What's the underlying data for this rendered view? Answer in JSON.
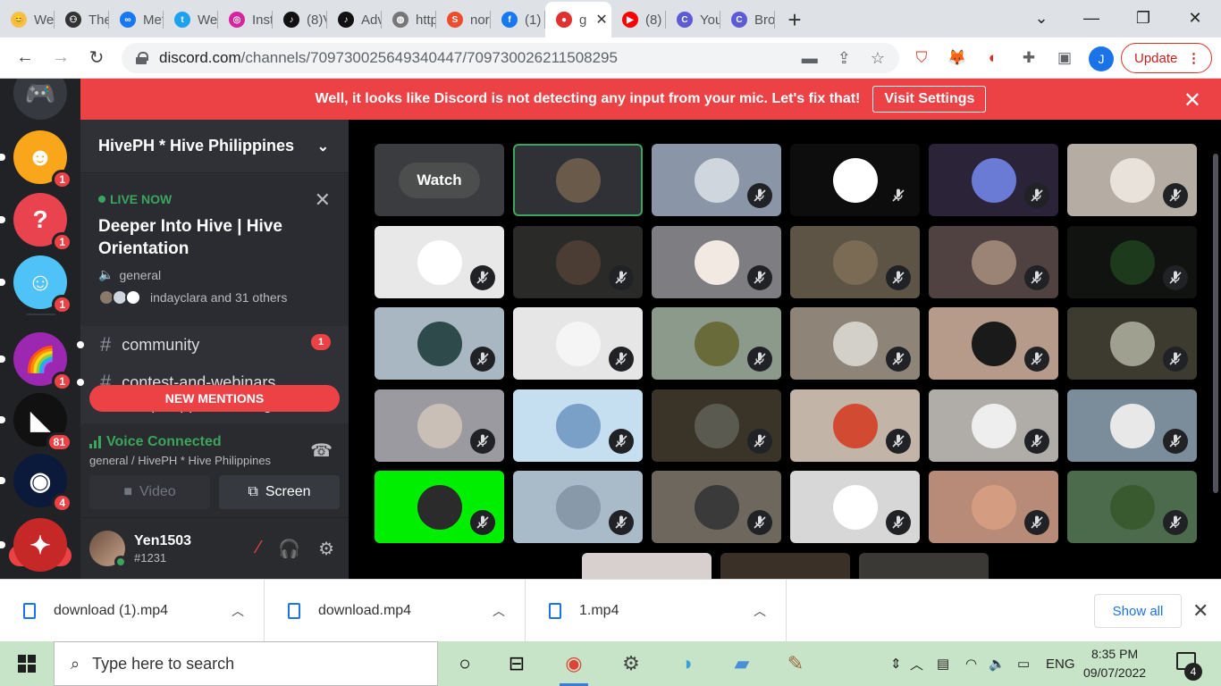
{
  "browser": {
    "tabs": [
      {
        "title": "We",
        "color": "#f6c04a",
        "glyph": "😊"
      },
      {
        "title": "The",
        "color": "#333333",
        "glyph": "⚇"
      },
      {
        "title": "Met",
        "color": "#1877f2",
        "glyph": "∞"
      },
      {
        "title": "We",
        "color": "#1da1f2",
        "glyph": "t"
      },
      {
        "title": "Inst",
        "color": "#d6249f",
        "glyph": "◎"
      },
      {
        "title": "(8)V",
        "color": "#111111",
        "glyph": "♪"
      },
      {
        "title": "Adv",
        "color": "#111111",
        "glyph": "♪"
      },
      {
        "title": "http",
        "color": "#777777",
        "glyph": "◍"
      },
      {
        "title": "nor",
        "color": "#ee4d2d",
        "glyph": "S"
      },
      {
        "title": "(1)",
        "color": "#1877f2",
        "glyph": "f"
      },
      {
        "title": "g",
        "color": "#e03030",
        "glyph": "●",
        "active": true
      },
      {
        "title": "(8)",
        "color": "#ff0000",
        "glyph": "▶"
      },
      {
        "title": "You",
        "color": "#5b5bd6",
        "glyph": "C"
      },
      {
        "title": "Bro",
        "color": "#5b5bd6",
        "glyph": "C"
      }
    ],
    "new_tab_glyph": "+",
    "address": "discord.com",
    "address_path": "/channels/709730025649340447/709730026211508295",
    "profile_initial": "J",
    "update_label": "Update"
  },
  "banner": {
    "message": "Well, it looks like Discord is not detecting any input from your mic. Let's fix that!",
    "button": "Visit Settings"
  },
  "guilds": [
    {
      "color": "#36393f",
      "glyph": "🎮",
      "badge": ""
    },
    {
      "color": "#faa61a",
      "glyph": "☻",
      "badge": "1"
    },
    {
      "color": "#e8434f",
      "glyph": "?",
      "badge": "1"
    },
    {
      "color": "#4fc3f7",
      "glyph": "☺",
      "badge": "1"
    },
    {
      "color": "#9c27b0",
      "glyph": "🌈",
      "badge": "1"
    },
    {
      "color": "#111111",
      "glyph": "◣",
      "badge": "81"
    },
    {
      "color": "#0b1a3a",
      "glyph": "◉",
      "badge": "4"
    },
    {
      "color": "#c62828",
      "glyph": "✦",
      "badge": ""
    }
  ],
  "new_badge": "NEW",
  "server": {
    "name": "HivePH * Hive Philippines",
    "live_now": "LIVE NOW",
    "live_title": "Deeper Into Hive | Hive Orientation",
    "live_channel": "general",
    "live_users": "indayclara and 31 others",
    "channels": [
      "community",
      "contest-and-webinars",
      "hivephilippines-delegat"
    ],
    "mention_count": "1",
    "new_mentions": "NEW MENTIONS"
  },
  "voice": {
    "status": "Voice Connected",
    "location": "general / HivePH * Hive Philippines",
    "video_label": "Video",
    "screen_label": "Screen"
  },
  "user": {
    "name": "Yen1503",
    "tag": "#1231"
  },
  "stage": {
    "watch_label": "Watch",
    "tiles": [
      {
        "bg": "#3a3c40",
        "av": "",
        "mute": false,
        "watch": true
      },
      {
        "bg": "#2f3136",
        "av": "#6a5a4a",
        "mute": false,
        "speaking": true
      },
      {
        "bg": "#8a95a8",
        "av": "#cfd6de",
        "mute": true
      },
      {
        "bg": "#0d0d0d",
        "av": "#ffffff",
        "mute": true,
        "slashonly": true
      },
      {
        "bg": "#2b2438",
        "av": "#6a7bd6",
        "mute": true
      },
      {
        "bg": "#b5aca4",
        "av": "#e9e2da",
        "mute": true
      },
      {
        "bg": "#e8e8e8",
        "av": "#ffffff",
        "mute": true
      },
      {
        "bg": "#2a2a28",
        "av": "#4b3d33",
        "mute": true
      },
      {
        "bg": "#7d7d82",
        "av": "#f1e9e2",
        "mute": true
      },
      {
        "bg": "#5d5446",
        "av": "#7b6b55",
        "mute": true
      },
      {
        "bg": "#4f4240",
        "av": "#9b8475",
        "mute": true
      },
      {
        "bg": "#111311",
        "av": "#1d3a1d",
        "mute": true
      },
      {
        "bg": "#a9b7c2",
        "av": "#2e4a4a",
        "mute": true
      },
      {
        "bg": "#e6e6e6",
        "av": "#f5f5f5",
        "mute": true
      },
      {
        "bg": "#8c9a8c",
        "av": "#6a6b3a",
        "mute": true
      },
      {
        "bg": "#8e8478",
        "av": "#d3cfc9",
        "mute": true
      },
      {
        "bg": "#b69a8a",
        "av": "#1a1a1a",
        "mute": true
      },
      {
        "bg": "#3d3b30",
        "av": "#a0a090",
        "mute": true
      },
      {
        "bg": "#9a9aa0",
        "av": "#c9bfb6",
        "mute": true
      },
      {
        "bg": "#c6dff0",
        "av": "#7aa0c8",
        "mute": true
      },
      {
        "bg": "#3a3428",
        "av": "#5a5a50",
        "mute": true
      },
      {
        "bg": "#c2b4a6",
        "av": "#d24a32",
        "mute": true
      },
      {
        "bg": "#b0aca8",
        "av": "#eeeeee",
        "mute": true
      },
      {
        "bg": "#7b8c9a",
        "av": "#e8e8e8",
        "mute": true
      },
      {
        "bg": "#00ee00",
        "av": "#2b2b2b",
        "mute": true
      },
      {
        "bg": "#a9bac9",
        "av": "#8899aa",
        "mute": true
      },
      {
        "bg": "#6e675e",
        "av": "#3a3a3a",
        "mute": true
      },
      {
        "bg": "#d7d7d7",
        "av": "#ffffff",
        "mute": true
      },
      {
        "bg": "#b88a78",
        "av": "#d49c80",
        "mute": true
      },
      {
        "bg": "#4c6a4c",
        "av": "#395a2f",
        "mute": true
      },
      {
        "bg": "#d8cfcf",
        "av": "#eeeeee",
        "mute": false
      },
      {
        "bg": "#3a3028",
        "av": "#7a6250",
        "mute": false
      },
      {
        "bg": "#3b3936",
        "av": "#e8e0dc",
        "mute": false
      }
    ]
  },
  "downloads": {
    "items": [
      "download (1).mp4",
      "download.mp4",
      "1.mp4"
    ],
    "show_all": "Show all"
  },
  "taskbar": {
    "search_placeholder": "Type here to search",
    "language": "ENG",
    "time": "8:35 PM",
    "date": "09/07/2022",
    "notifications": "4"
  }
}
